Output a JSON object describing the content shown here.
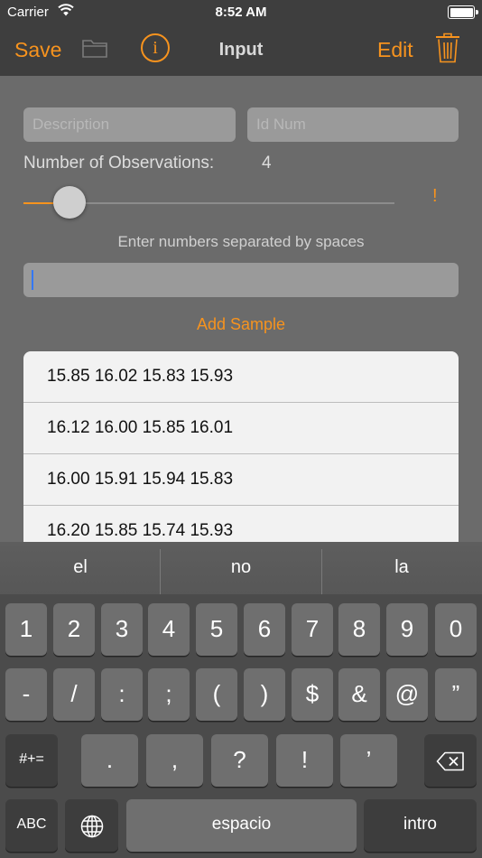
{
  "status_bar": {
    "carrier": "Carrier",
    "time": "8:52 AM"
  },
  "nav": {
    "save_label": "Save",
    "info_label": "i",
    "title": "Input",
    "edit_label": "Edit"
  },
  "form": {
    "description_placeholder": "Description",
    "idnum_placeholder": "Id Num",
    "observations_label": "Number of Observations:",
    "observations_value": "4",
    "slider": {
      "min": 2,
      "max": 25,
      "value": 4
    },
    "warning": "!",
    "hint": "Enter numbers separated by spaces",
    "input_value": "",
    "add_sample_label": "Add Sample"
  },
  "samples": [
    "15.85 16.02 15.83 15.93",
    "16.12 16.00 15.85 16.01",
    "16.00 15.91 15.94 15.83",
    "16.20 15.85 15.74 15.93"
  ],
  "keyboard": {
    "predictions": [
      "el",
      "no",
      "la"
    ],
    "row1": [
      "1",
      "2",
      "3",
      "4",
      "5",
      "6",
      "7",
      "8",
      "9",
      "0"
    ],
    "row2": [
      "-",
      "/",
      ":",
      ";",
      "(",
      ")",
      "$",
      "&",
      "@",
      "”"
    ],
    "row3_mode": "#+=",
    "row3": [
      ".",
      ",",
      "?",
      "!",
      "’"
    ],
    "abc_label": "ABC",
    "space_label": "espacio",
    "return_label": "intro"
  },
  "colors": {
    "accent": "#f7931e",
    "nav_background": "#3e3e3e",
    "background": "#6b6b6b",
    "cursor": "#3478f6"
  },
  "icons": {
    "wifi": "wifi-icon",
    "battery": "battery-icon",
    "folder": "folder-icon",
    "info": "info-icon",
    "trash": "trash-icon",
    "globe": "globe-icon",
    "backspace": "backspace-icon"
  }
}
